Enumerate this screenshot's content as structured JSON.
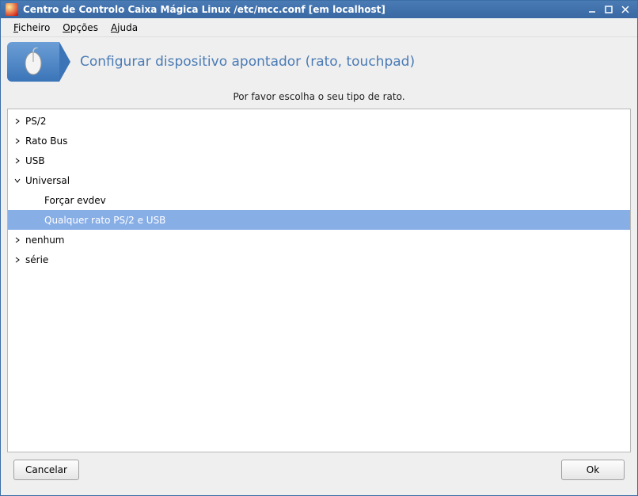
{
  "titlebar": {
    "title": "Centro de Controlo Caixa Mágica Linux /etc/mcc.conf [em localhost]"
  },
  "menu": {
    "file_pre": "F",
    "file": "icheiro",
    "options_pre": "O",
    "options": "pções",
    "help_pre": "A",
    "help": "juda"
  },
  "banner": {
    "title": "Configurar dispositivo apontador (rato, touchpad)"
  },
  "instruction": "Por favor escolha o seu tipo de rato.",
  "tree": {
    "ps2": "PS/2",
    "ratobus": "Rato Bus",
    "usb": "USB",
    "universal": "Universal",
    "forcar_evdev": "Forçar evdev",
    "qualquer": "Qualquer rato PS/2 e USB",
    "nenhum": "nenhum",
    "serie": "série"
  },
  "buttons": {
    "cancel": "Cancelar",
    "ok": "Ok"
  }
}
